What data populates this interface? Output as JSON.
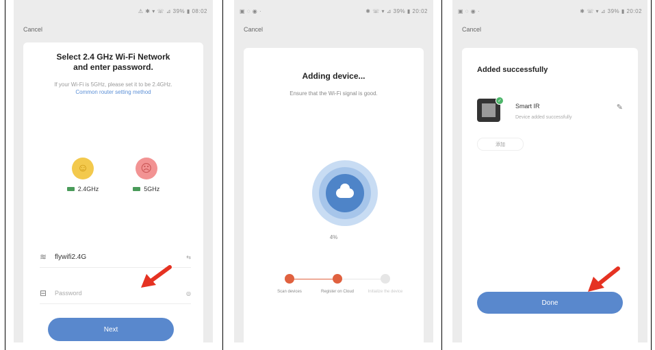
{
  "separators": true,
  "screen1": {
    "status": "⚠ ✱ ▾ ☏ ⊿ 39% ▮ 08:02",
    "cancel": "Cancel",
    "title_line1": "Select 2.4 GHz Wi-Fi Network",
    "title_line2": "and enter password.",
    "subtitle_plain": "If your Wi-Fi is 5GHz, please set it to be 2.4GHz.",
    "subtitle_link": "Common router setting method",
    "band_good": "2.4GHz",
    "band_bad": "5GHz",
    "wifi_name": "flywifi2.4G",
    "wifi_right": "⇆",
    "password_placeholder": "Password",
    "password_right": "◎",
    "next_button": "Next",
    "colors": {
      "accent": "#5988cd",
      "arrow": "#e53222"
    }
  },
  "screen2": {
    "status_left": "▣ ◌ ◉ ·",
    "status_right": "✱ ☏ ▾ ⊿ 39% ▮ 20:02",
    "cancel": "Cancel",
    "title": "Adding device...",
    "subtitle": "Ensure that the Wi-Fi signal is good.",
    "progress_percent": "4%",
    "steps": [
      {
        "label": "Scan devices",
        "state": "done"
      },
      {
        "label": "Register on Cloud",
        "state": "done"
      },
      {
        "label": "Initialize the device",
        "state": "pending"
      }
    ],
    "colors": {
      "step_active": "#e0613f",
      "step_pending": "#e6e6e6",
      "ring": "#4e84c8"
    }
  },
  "screen3": {
    "status_left": "▣ ◌ ◉ ·",
    "status_right": "✱ ☏ ▾ ⊿ 39% ▮ 20:02",
    "cancel": "Cancel",
    "title": "Added successfully",
    "device_name": "Smart IR",
    "device_status": "Device added successfully",
    "room_button": "添加",
    "done_button": "Done",
    "colors": {
      "check": "#4db56a"
    }
  }
}
